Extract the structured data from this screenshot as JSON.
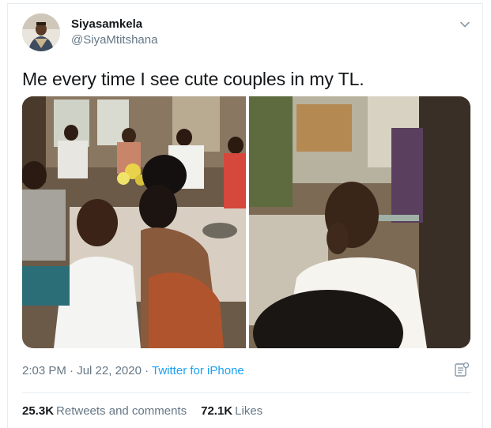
{
  "user": {
    "display_name": "Siyasamkela",
    "handle": "@SiyaMtitshana"
  },
  "tweet": {
    "text": "Me every time I see cute couples in my TL."
  },
  "meta": {
    "time": "2:03 PM",
    "date": "Jul 22, 2020",
    "separator": " · ",
    "source": "Twitter for iPhone"
  },
  "stats": {
    "retweets_count": "25.3K",
    "retweets_label": "Retweets and comments",
    "likes_count": "72.1K",
    "likes_label": "Likes"
  },
  "icons": {
    "caret": "chevron-down-icon",
    "analytics": "analytics-icon"
  },
  "colors": {
    "link": "#1da1f2",
    "secondary_text": "#657786",
    "border": "#e6ecf0"
  }
}
